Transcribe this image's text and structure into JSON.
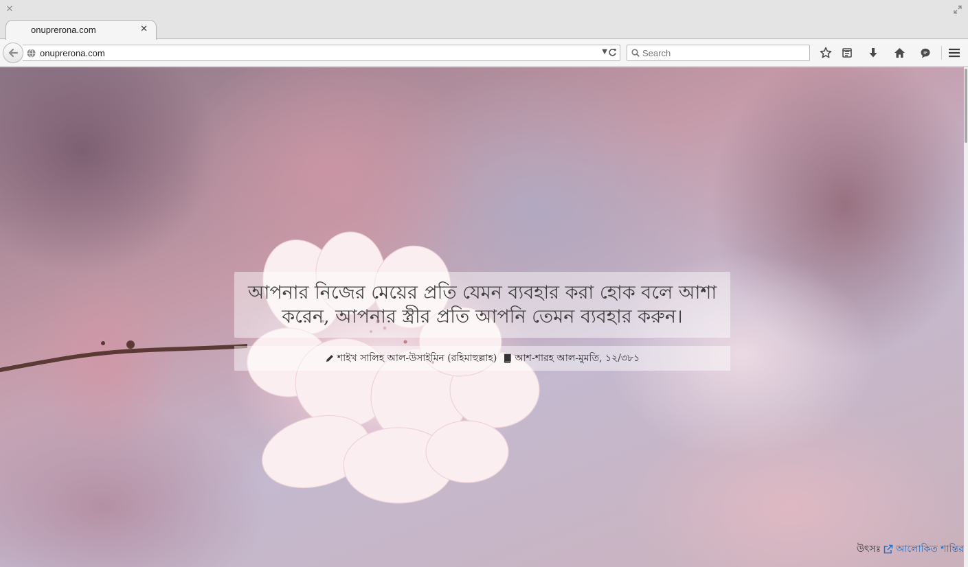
{
  "browser": {
    "tab_title": "onuprerona.com",
    "url": "onuprerona.com",
    "search_placeholder": "Search"
  },
  "quote": {
    "text": "আপনার নিজের মেয়ের প্রতি যেমন ব্যবহার করা হোক বলে আশা করেন, আপনার স্ত্রীর প্রতি আপনি তেমন ব্যবহার করুন।",
    "author": "শাইখ সালিহ আল-উসাইমিন (রহিমাহুল্লাহ)",
    "book": "আশ-শারহ আল-মুমতি, ১২/৩৮১"
  },
  "source": {
    "label": "উৎসঃ",
    "link_text": "আলোকিত শান্তির"
  },
  "colors": {
    "link": "#1f6fc4",
    "quote_text": "#3f3f3f"
  },
  "icons": [
    "close-icon",
    "restore-icon",
    "back-arrow-icon",
    "globe-icon",
    "dropdown-icon",
    "reload-icon",
    "search-icon",
    "bookmark-star-icon",
    "reading-list-icon",
    "download-icon",
    "home-icon",
    "chat-icon",
    "hamburger-menu-icon",
    "pencil-icon",
    "book-icon",
    "external-link-icon"
  ]
}
